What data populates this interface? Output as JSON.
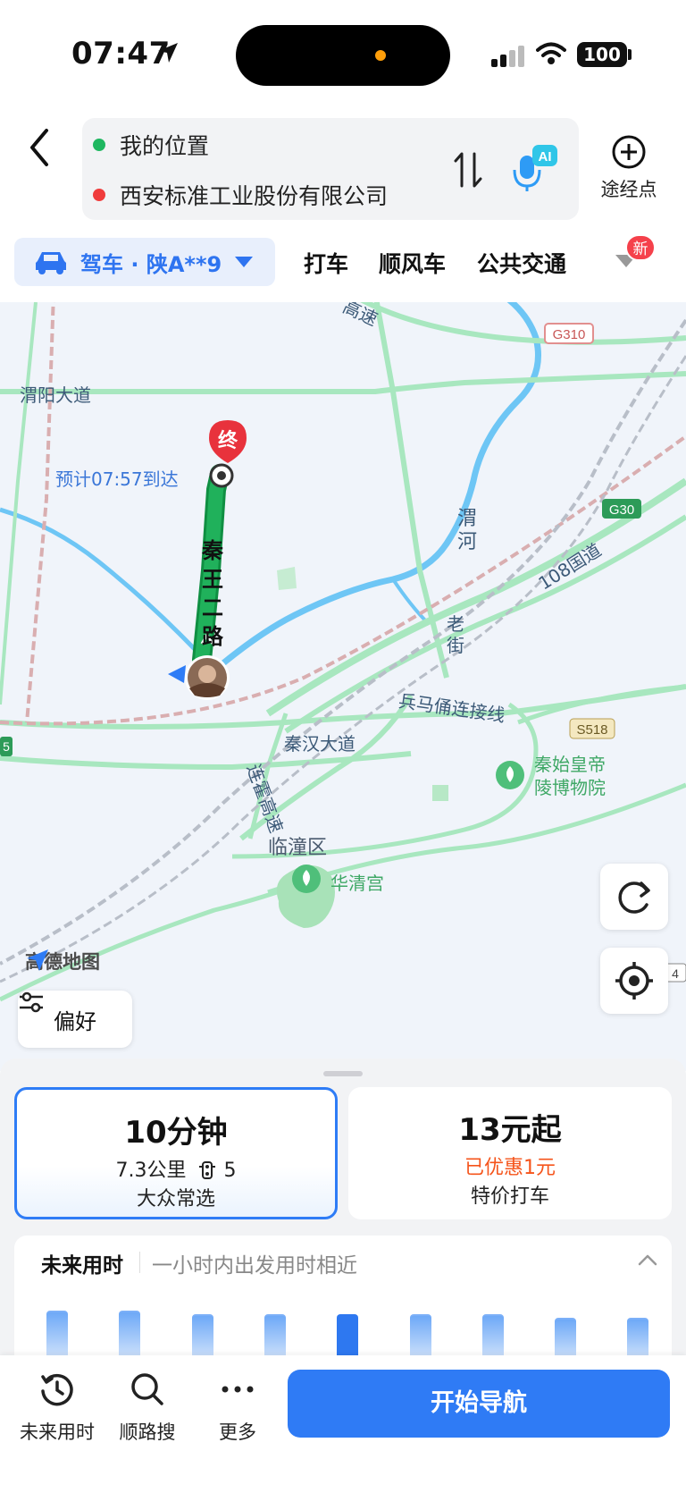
{
  "status_bar": {
    "time": "07:47",
    "battery": "100"
  },
  "header": {
    "origin": "我的位置",
    "destination": "西安标准工业股份有限公司",
    "waypoint_label": "途经点",
    "voice_badge": "AI"
  },
  "modes": {
    "drive": "驾车 · 陕A**9",
    "tabs": [
      "打车",
      "顺风车",
      "公共交通"
    ],
    "new_badge": "新"
  },
  "map": {
    "eta": "预计07:57到达",
    "end_marker": "终",
    "route_road": "秦王二路",
    "labels": {
      "weiyang": "渭阳大道",
      "gaosu_top": "高速",
      "g310": "G310",
      "g30": "G30",
      "wei_river": "渭河",
      "road_108": "108国道",
      "laojie": "老街",
      "bingma": "兵马俑连接线",
      "s518": "S518",
      "qinhan": "秦汉大道",
      "lianhuo": "连霍高速",
      "mausoleum": "秦始皇帝陵博物院",
      "lintong": "临潼区",
      "huaqing": "华清宫",
      "shield_4": "4",
      "shield_5": "5"
    },
    "logo": "高德地图",
    "preference": "偏好"
  },
  "route_cards": [
    {
      "title": "10分钟",
      "distance": "7.3公里",
      "lights": "5",
      "tag": "大众常选"
    },
    {
      "title": "13元起",
      "discount": "已优惠1元",
      "tag": "特价打车"
    }
  ],
  "future": {
    "title": "未来用时",
    "desc": "一小时内出发用时相近",
    "levels": [
      0.67,
      0.67,
      0.63,
      0.63,
      0.63,
      0.63,
      0.63,
      0.58,
      0.58
    ],
    "active_index": 4
  },
  "bottom_bar": {
    "tools": [
      "未来用时",
      "顺路搜",
      "更多"
    ],
    "start": "开始导航"
  },
  "colors": {
    "accent": "#2f7bf5",
    "route": "#1ea755",
    "discount": "#f5541b",
    "water": "#6ec6f5"
  }
}
